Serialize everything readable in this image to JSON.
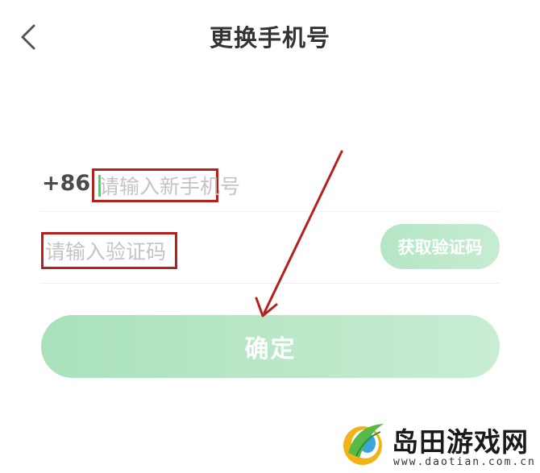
{
  "header": {
    "title": "更换手机号",
    "back_icon": "chevron-left-icon"
  },
  "form": {
    "country_code": "+86",
    "phone_placeholder": "请输入新手机号",
    "phone_value": "",
    "code_placeholder": "请输入验证码",
    "code_value": "",
    "get_code_label": "获取验证码",
    "confirm_label": "确定"
  },
  "watermark": {
    "title": "岛田游戏网",
    "url": "www.daotian.com.cn"
  },
  "colors": {
    "title_text": "#333333",
    "annotation_red": "#b5211d",
    "caret_green": "#6cc07c",
    "button_green": "#a9e1bb",
    "button_green_light": "#c8edd3"
  }
}
